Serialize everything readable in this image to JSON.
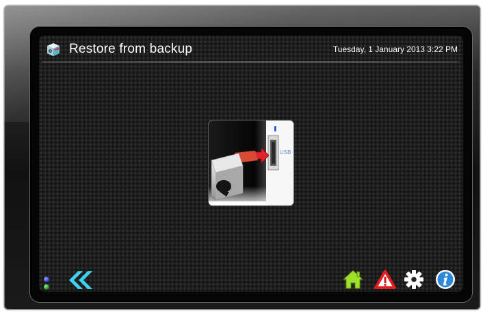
{
  "header": {
    "title": "Restore from backup",
    "datetime": "Tuesday, 1 January 2013 3:22 PM"
  },
  "illustration": {
    "port_label": "USB",
    "icon": "usb-insert-illustration"
  },
  "status_leds": [
    {
      "name": "blue-led",
      "color": "#3a46e0"
    },
    {
      "name": "green-led",
      "color": "#2fb02f"
    }
  ],
  "toolbar": {
    "back_icon": "double-chevron-left-icon",
    "home_icon": "home-icon",
    "alert_icon": "warning-icon",
    "settings_icon": "gear-icon",
    "info_icon": "info-icon"
  },
  "colors": {
    "accent_cyan": "#3fd0f0",
    "home_green": "#9fe02c",
    "alert_red": "#e02020",
    "info_blue": "#2e88d8"
  }
}
